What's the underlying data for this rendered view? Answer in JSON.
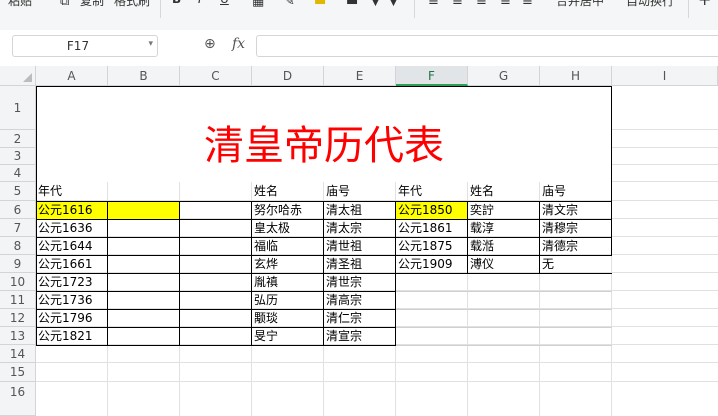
{
  "ribbon": {
    "labels": [
      {
        "text": "粘贴"
      },
      {
        "text": "复制"
      },
      {
        "text": "格式刷"
      },
      {
        "text": "B"
      },
      {
        "text": "I"
      },
      {
        "text": "U"
      },
      {
        "text": "合并居中"
      },
      {
        "text": "自动换行"
      },
      {
        "text": "+"
      }
    ]
  },
  "formula_bar": {
    "name_box": "F17",
    "fx_label": "fx",
    "formula": ""
  },
  "grid": {
    "columns": [
      "A",
      "B",
      "C",
      "D",
      "E",
      "F",
      "G",
      "H",
      "I"
    ],
    "active_column": "F",
    "rows": [
      "1",
      "2",
      "3",
      "4",
      "5",
      "6",
      "7",
      "8",
      "9",
      "10",
      "11",
      "12",
      "13",
      "14",
      "15",
      "16"
    ],
    "highlight_color": "#ffff00",
    "title_color": "#ff0000"
  },
  "sheet": {
    "title": "清皇帝历代表",
    "header": {
      "a": "年代",
      "d": "姓名",
      "e": "庙号",
      "f": "年代",
      "g": "姓名",
      "h": "庙号"
    },
    "left_rows": [
      {
        "year": "公元1616",
        "name": "努尔哈赤",
        "temple": "清太祖"
      },
      {
        "year": "公元1636",
        "name": "皇太极",
        "temple": "清太宗"
      },
      {
        "year": "公元1644",
        "name": "福临",
        "temple": "清世祖"
      },
      {
        "year": "公元1661",
        "name": "玄烨",
        "temple": "清圣祖"
      },
      {
        "year": "公元1723",
        "name": "胤禛",
        "temple": "清世宗"
      },
      {
        "year": "公元1736",
        "name": "弘历",
        "temple": "清高宗"
      },
      {
        "year": "公元1796",
        "name": "颙琰",
        "temple": "清仁宗"
      },
      {
        "year": "公元1821",
        "name": "旻宁",
        "temple": "清宣宗"
      }
    ],
    "right_rows": [
      {
        "year": "公元1850",
        "name": "奕詝",
        "temple": "清文宗"
      },
      {
        "year": "公元1861",
        "name": "载淳",
        "temple": "清穆宗"
      },
      {
        "year": "公元1875",
        "name": "载湉",
        "temple": "清德宗"
      },
      {
        "year": "公元1909",
        "name": "溥仪",
        "temple": "无"
      }
    ]
  }
}
